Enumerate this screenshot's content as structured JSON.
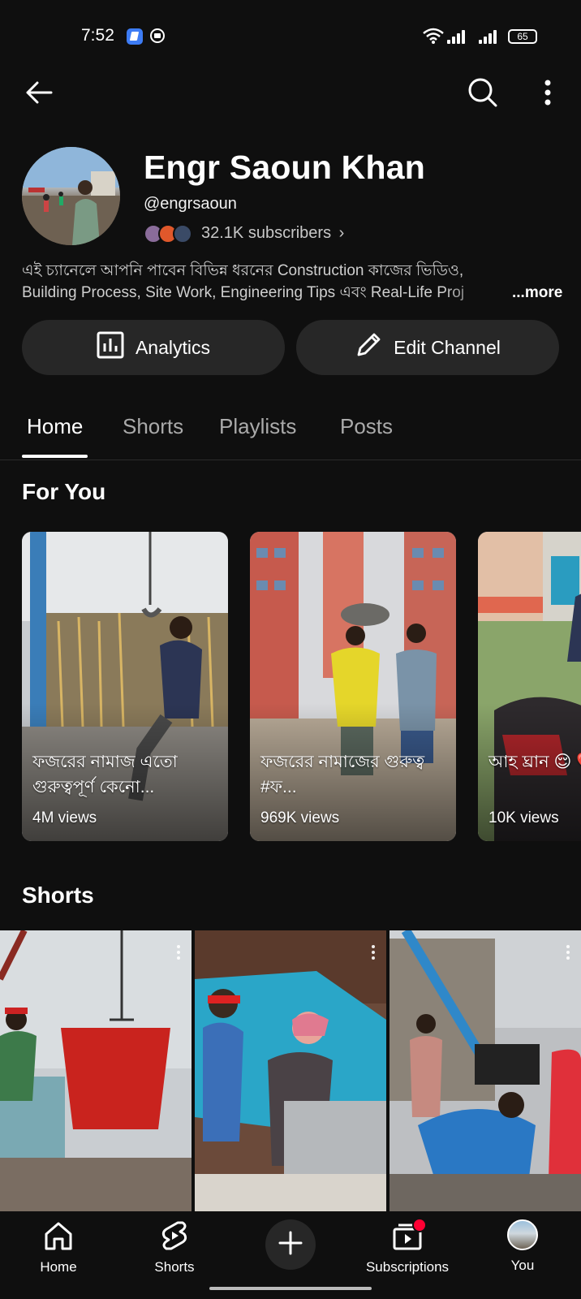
{
  "status_bar": {
    "time": "7:52",
    "battery": "65"
  },
  "channel": {
    "name": "Engr Saoun Khan",
    "handle": "@engrsaoun",
    "subscribers": "32.1K subscribers",
    "subscribers_chevron": "›",
    "description_line1": "এই চ্যানেলে আপনি পাবেন বিভিন্ন ধরনের Construction কাজের ভিডিও,",
    "description_line2": "Building Process, Site Work, Engineering Tips এবং Real-Life Proj",
    "more_label": "...more"
  },
  "actions": {
    "analytics_label": "Analytics",
    "edit_label": "Edit Channel"
  },
  "tabs": [
    {
      "label": "Home",
      "active": true
    },
    {
      "label": "Shorts",
      "active": false
    },
    {
      "label": "Playlists",
      "active": false
    },
    {
      "label": "Posts",
      "active": false
    }
  ],
  "for_you": {
    "title": "For You",
    "cards": [
      {
        "title": "ফজরের নামাজ এতো গুরুত্বপূর্ণ কেনো...",
        "views": "4M views"
      },
      {
        "title": "ফজরের নামাজের গুরুত্ব #ফ...",
        "views": "969K views"
      },
      {
        "title": "আহ ঘ্রান 😌 ❤️ #ytshor",
        "views": "10K views"
      }
    ]
  },
  "shorts_section": {
    "title": "Shorts"
  },
  "bottom_nav": [
    {
      "label": "Home",
      "icon": "home-icon"
    },
    {
      "label": "Shorts",
      "icon": "shorts-icon"
    },
    {
      "label": "",
      "icon": "create-icon"
    },
    {
      "label": "Subscriptions",
      "icon": "subscriptions-icon"
    },
    {
      "label": "You",
      "icon": "profile-avatar"
    }
  ],
  "colors": {
    "background": "#0f0f0f",
    "pill": "#272727",
    "notification": "#ff0033"
  }
}
